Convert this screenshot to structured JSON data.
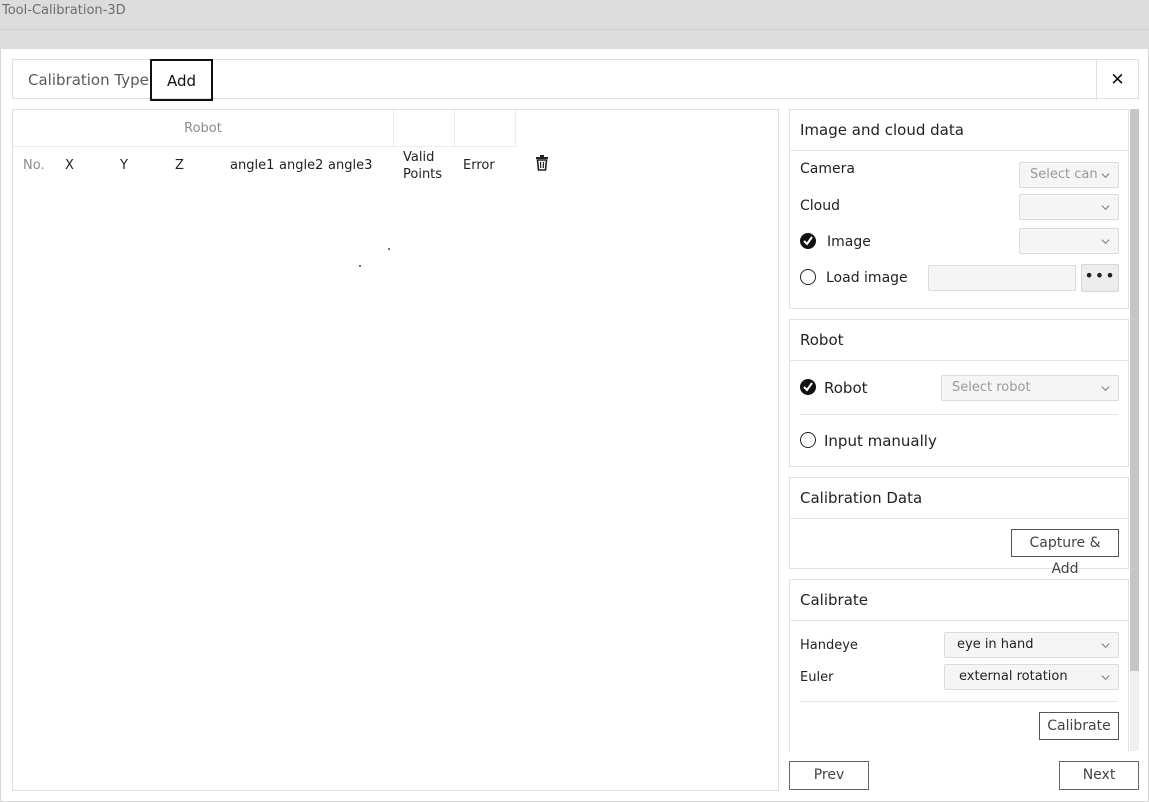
{
  "window": {
    "title": "Tool-Calibration-3D"
  },
  "tabs": {
    "calibration_type": "Calibration Type",
    "add": "Add"
  },
  "table": {
    "group_header": "Robot",
    "columns": {
      "no": "No.",
      "x": "X",
      "y": "Y",
      "z": "Z",
      "angle1": "angle1",
      "angle2": "angle2",
      "angle3": "angle3",
      "valid_line1": "Valid",
      "valid_line2": "Points",
      "error": "Error"
    }
  },
  "image_cloud": {
    "title": "Image and cloud data",
    "camera_label": "Camera",
    "camera_placeholder": "Select can",
    "cloud_label": "Cloud",
    "image_label": "Image",
    "load_image_label": "Load image",
    "more_button": "•••"
  },
  "robot": {
    "title": "Robot",
    "robot_option": "Robot",
    "robot_placeholder": "Select robot",
    "manual_option": "Input manually"
  },
  "calibration_data": {
    "title": "Calibration Data",
    "capture_button": "Capture & Add"
  },
  "calibrate": {
    "title": "Calibrate",
    "handeye_label": "Handeye",
    "handeye_value": "eye in hand",
    "euler_label": "Euler",
    "euler_value": "external rotation",
    "calibrate_button": "Calibrate"
  },
  "nav": {
    "prev": "Prev",
    "next": "Next"
  }
}
